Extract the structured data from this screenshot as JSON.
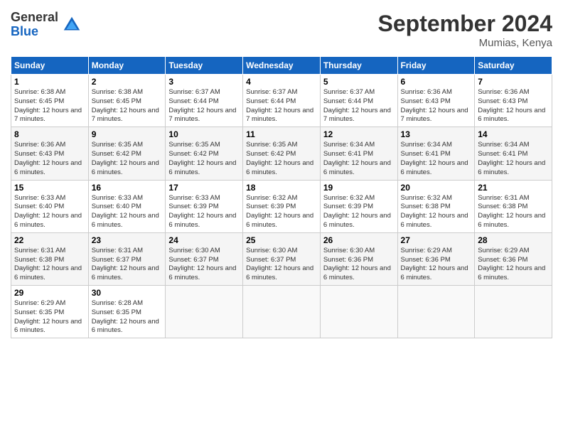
{
  "logo": {
    "general": "General",
    "blue": "Blue"
  },
  "header": {
    "month": "September 2024",
    "location": "Mumias, Kenya"
  },
  "weekdays": [
    "Sunday",
    "Monday",
    "Tuesday",
    "Wednesday",
    "Thursday",
    "Friday",
    "Saturday"
  ],
  "weeks": [
    [
      {
        "day": 1,
        "sunrise": "6:38 AM",
        "sunset": "6:45 PM",
        "daylight": "12 hours and 7 minutes"
      },
      {
        "day": 2,
        "sunrise": "6:38 AM",
        "sunset": "6:45 PM",
        "daylight": "12 hours and 7 minutes"
      },
      {
        "day": 3,
        "sunrise": "6:37 AM",
        "sunset": "6:44 PM",
        "daylight": "12 hours and 7 minutes"
      },
      {
        "day": 4,
        "sunrise": "6:37 AM",
        "sunset": "6:44 PM",
        "daylight": "12 hours and 7 minutes"
      },
      {
        "day": 5,
        "sunrise": "6:37 AM",
        "sunset": "6:44 PM",
        "daylight": "12 hours and 7 minutes"
      },
      {
        "day": 6,
        "sunrise": "6:36 AM",
        "sunset": "6:43 PM",
        "daylight": "12 hours and 7 minutes"
      },
      {
        "day": 7,
        "sunrise": "6:36 AM",
        "sunset": "6:43 PM",
        "daylight": "12 hours and 6 minutes"
      }
    ],
    [
      {
        "day": 8,
        "sunrise": "6:36 AM",
        "sunset": "6:43 PM",
        "daylight": "12 hours and 6 minutes"
      },
      {
        "day": 9,
        "sunrise": "6:35 AM",
        "sunset": "6:42 PM",
        "daylight": "12 hours and 6 minutes"
      },
      {
        "day": 10,
        "sunrise": "6:35 AM",
        "sunset": "6:42 PM",
        "daylight": "12 hours and 6 minutes"
      },
      {
        "day": 11,
        "sunrise": "6:35 AM",
        "sunset": "6:42 PM",
        "daylight": "12 hours and 6 minutes"
      },
      {
        "day": 12,
        "sunrise": "6:34 AM",
        "sunset": "6:41 PM",
        "daylight": "12 hours and 6 minutes"
      },
      {
        "day": 13,
        "sunrise": "6:34 AM",
        "sunset": "6:41 PM",
        "daylight": "12 hours and 6 minutes"
      },
      {
        "day": 14,
        "sunrise": "6:34 AM",
        "sunset": "6:41 PM",
        "daylight": "12 hours and 6 minutes"
      }
    ],
    [
      {
        "day": 15,
        "sunrise": "6:33 AM",
        "sunset": "6:40 PM",
        "daylight": "12 hours and 6 minutes"
      },
      {
        "day": 16,
        "sunrise": "6:33 AM",
        "sunset": "6:40 PM",
        "daylight": "12 hours and 6 minutes"
      },
      {
        "day": 17,
        "sunrise": "6:33 AM",
        "sunset": "6:39 PM",
        "daylight": "12 hours and 6 minutes"
      },
      {
        "day": 18,
        "sunrise": "6:32 AM",
        "sunset": "6:39 PM",
        "daylight": "12 hours and 6 minutes"
      },
      {
        "day": 19,
        "sunrise": "6:32 AM",
        "sunset": "6:39 PM",
        "daylight": "12 hours and 6 minutes"
      },
      {
        "day": 20,
        "sunrise": "6:32 AM",
        "sunset": "6:38 PM",
        "daylight": "12 hours and 6 minutes"
      },
      {
        "day": 21,
        "sunrise": "6:31 AM",
        "sunset": "6:38 PM",
        "daylight": "12 hours and 6 minutes"
      }
    ],
    [
      {
        "day": 22,
        "sunrise": "6:31 AM",
        "sunset": "6:38 PM",
        "daylight": "12 hours and 6 minutes"
      },
      {
        "day": 23,
        "sunrise": "6:31 AM",
        "sunset": "6:37 PM",
        "daylight": "12 hours and 6 minutes"
      },
      {
        "day": 24,
        "sunrise": "6:30 AM",
        "sunset": "6:37 PM",
        "daylight": "12 hours and 6 minutes"
      },
      {
        "day": 25,
        "sunrise": "6:30 AM",
        "sunset": "6:37 PM",
        "daylight": "12 hours and 6 minutes"
      },
      {
        "day": 26,
        "sunrise": "6:30 AM",
        "sunset": "6:36 PM",
        "daylight": "12 hours and 6 minutes"
      },
      {
        "day": 27,
        "sunrise": "6:29 AM",
        "sunset": "6:36 PM",
        "daylight": "12 hours and 6 minutes"
      },
      {
        "day": 28,
        "sunrise": "6:29 AM",
        "sunset": "6:36 PM",
        "daylight": "12 hours and 6 minutes"
      }
    ],
    [
      {
        "day": 29,
        "sunrise": "6:29 AM",
        "sunset": "6:35 PM",
        "daylight": "12 hours and 6 minutes"
      },
      {
        "day": 30,
        "sunrise": "6:28 AM",
        "sunset": "6:35 PM",
        "daylight": "12 hours and 6 minutes"
      },
      null,
      null,
      null,
      null,
      null
    ]
  ]
}
